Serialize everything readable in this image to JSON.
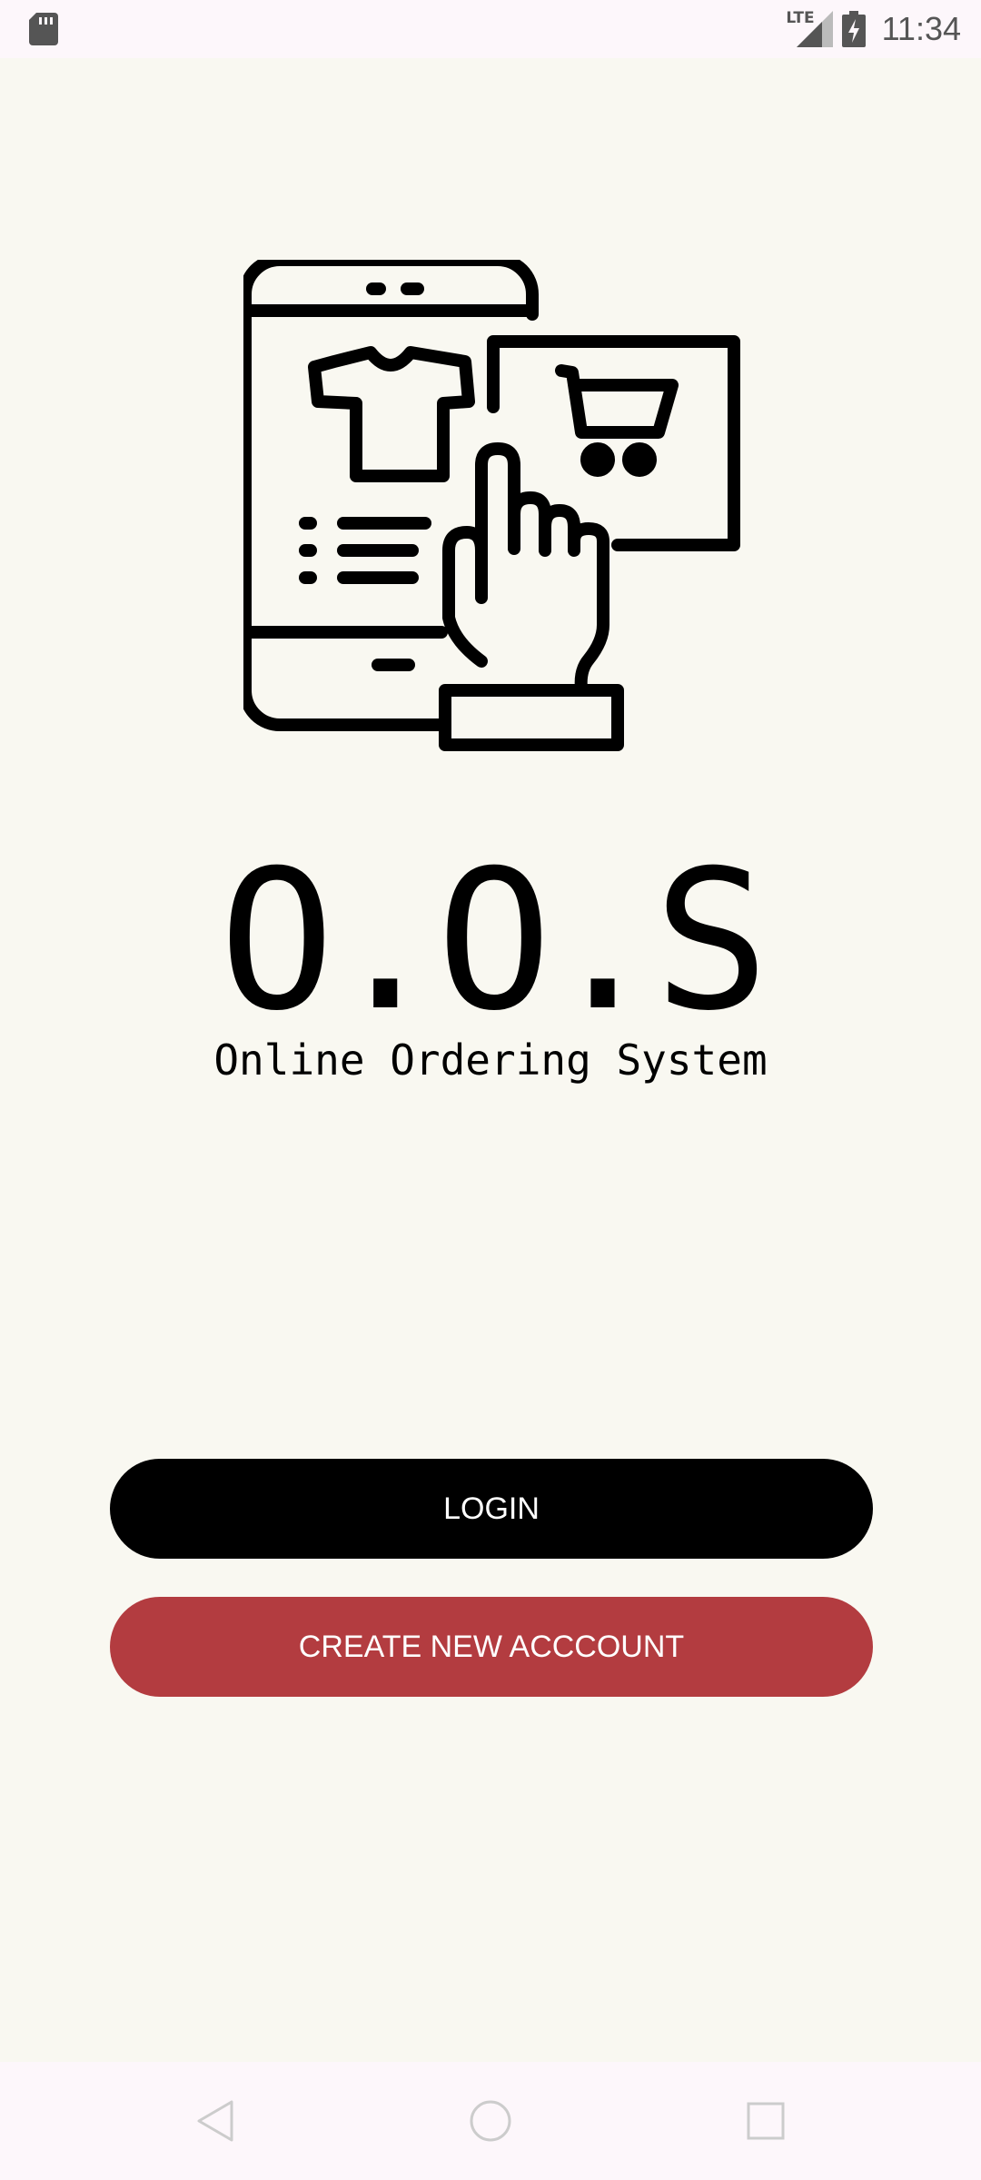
{
  "status_bar": {
    "network": "LTE",
    "time": "11:34",
    "icons": [
      "sd-card-icon",
      "signal-icon",
      "battery-charging-icon"
    ]
  },
  "app": {
    "logo_title": "O.O.S",
    "logo_subtitle": "Online Ordering System",
    "illustration": "phone-shopping-hand-cart-icon"
  },
  "buttons": {
    "login_label": "LOGIN",
    "create_account_label": "CREATE NEW ACCCOUNT"
  },
  "colors": {
    "background": "#f9f8f1",
    "login_button": "#000000",
    "create_button": "#b33c40",
    "system_bars": "#fdf7fb"
  },
  "nav_bar": {
    "icons": [
      "back-icon",
      "home-icon",
      "recents-icon"
    ]
  }
}
